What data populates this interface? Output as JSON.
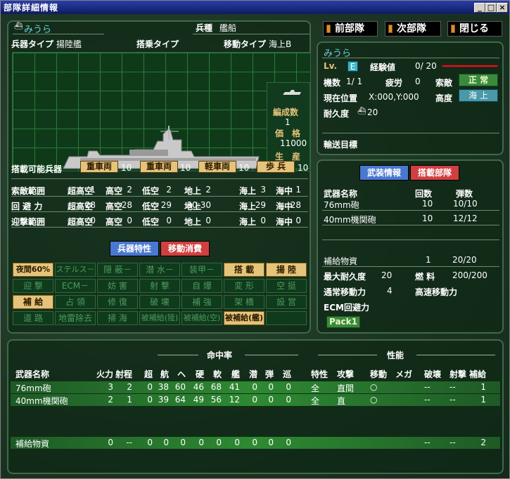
{
  "window": {
    "title": "部隊詳細情報",
    "min": "_",
    "max": "□",
    "close": "×"
  },
  "unit": {
    "name": "みうら",
    "type_label": "兵種",
    "type": "艦船"
  },
  "type_row": {
    "weapon_type_label": "兵器タイプ",
    "weapon_type": "揚陸艦",
    "board_label": "搭乗タイプ",
    "board": "",
    "move_label": "移動タイプ",
    "move": "海上B"
  },
  "info": {
    "formation_label": "編成数",
    "formation": "1",
    "price_label": "価　格",
    "price": "11000",
    "prod_label": "生　産",
    "prod": "－"
  },
  "carry": {
    "label": "搭載可能兵器",
    "items": [
      {
        "name": "重車両",
        "count": "10"
      },
      {
        "name": "重車両",
        "count": "10"
      },
      {
        "name": "軽車両",
        "count": "10"
      },
      {
        "name": "歩 兵",
        "count": "10"
      }
    ]
  },
  "ranges": [
    {
      "label": "索敵範囲",
      "vals": [
        "超高空",
        "1",
        "高空",
        "2",
        "低空",
        "2",
        "地上",
        "2",
        "海上",
        "3",
        "海中",
        "1"
      ]
    },
    {
      "label": "回 避 力",
      "vals": [
        "超高空",
        "28",
        "高空",
        "28",
        "低空",
        "29",
        "地上",
        "30:30",
        "海上",
        "29",
        "海中",
        "28"
      ]
    },
    {
      "label": "迎撃範囲",
      "vals": [
        "超高空",
        "0",
        "高空",
        "0",
        "低空",
        "0",
        "地上",
        "0",
        "海上",
        "0",
        "海中",
        "0"
      ]
    }
  ],
  "mid_tabs": {
    "weapon_traits": "兵器特性",
    "move_cost": "移動消費"
  },
  "traits": [
    [
      "夜間60%",
      "ステルス－",
      "隠 蔽－",
      "潜 水－",
      "装甲－",
      "搭 載",
      "揚 陸"
    ],
    [
      "迎 撃",
      "ECM－",
      "妨 害",
      "射 撃",
      "自 爆",
      "変 形",
      "空 挺"
    ],
    [
      "補 給",
      "占 領",
      "修 復",
      "破 壊",
      "補 強",
      "架 橋",
      "設 営"
    ],
    [
      "道 路",
      "地雷除去",
      "掃 海",
      "被補給(陸)",
      "被補給(空)",
      "被補給(艦)",
      ""
    ]
  ],
  "nav": {
    "prev": "前部隊",
    "next": "次部隊",
    "close": "閉じる"
  },
  "status": {
    "name": "みうら",
    "lv_label": "Lv.",
    "lv": "E",
    "exp_label": "経験値",
    "exp": "0/ 20",
    "count_label": "機数",
    "count": "1/ 1",
    "fatigue_label": "疲労",
    "fatigue": "0",
    "search_label": "索敵",
    "search": "正 常",
    "pos_label": "現在位置",
    "pos": "X:000,Y:000",
    "alt_label": "高度",
    "alt": "海 上",
    "dur_label": "耐久度",
    "dur": "20",
    "dest_label": "輸送目標",
    "dest": ""
  },
  "arm_tabs": {
    "armament": "武装情報",
    "cargo": "搭載部隊"
  },
  "arms": {
    "headers": [
      "武器名称",
      "回数",
      "弾数"
    ],
    "rows": [
      [
        "76mm砲",
        "10",
        "10/10"
      ],
      [
        "40mm機関砲",
        "10",
        "12/12"
      ]
    ],
    "supply": [
      "補給物資",
      "1",
      "20/20"
    ],
    "max_dur_label": "最大耐久度",
    "max_dur": "20",
    "fuel_label": "燃 料",
    "fuel": "200/200",
    "move_label": "通常移動力",
    "move": "4",
    "fast_label": "高速移動力",
    "fast": "",
    "ecm_label": "ECM回避力",
    "pack": "Pack1"
  },
  "table": {
    "group_hit": "命中率",
    "group_perf": "性能",
    "headers": [
      "武器名称",
      "火力",
      "射程",
      "超",
      "航",
      "ヘ",
      "硬",
      "軟",
      "艦",
      "潜",
      "弾",
      "巡",
      "特性",
      "攻撃",
      "移動",
      "メガ",
      "破壊",
      "射撃",
      "補給"
    ],
    "rows": [
      [
        "76mm砲",
        "3",
        "2",
        "0",
        "38",
        "60",
        "46",
        "68",
        "41",
        "0",
        "0",
        "0",
        "全",
        "直間",
        "○",
        "",
        "--",
        "--",
        "1"
      ],
      [
        "40mm機関砲",
        "2",
        "1",
        "0",
        "39",
        "64",
        "49",
        "56",
        "12",
        "0",
        "0",
        "0",
        "全",
        "直",
        "○",
        "",
        "--",
        "--",
        "1"
      ],
      [
        "補給物資",
        "0",
        "--",
        "0",
        "0",
        "0",
        "0",
        "0",
        "0",
        "0",
        "0",
        "0",
        "",
        "",
        "",
        "",
        "--",
        "--",
        "2"
      ]
    ]
  }
}
